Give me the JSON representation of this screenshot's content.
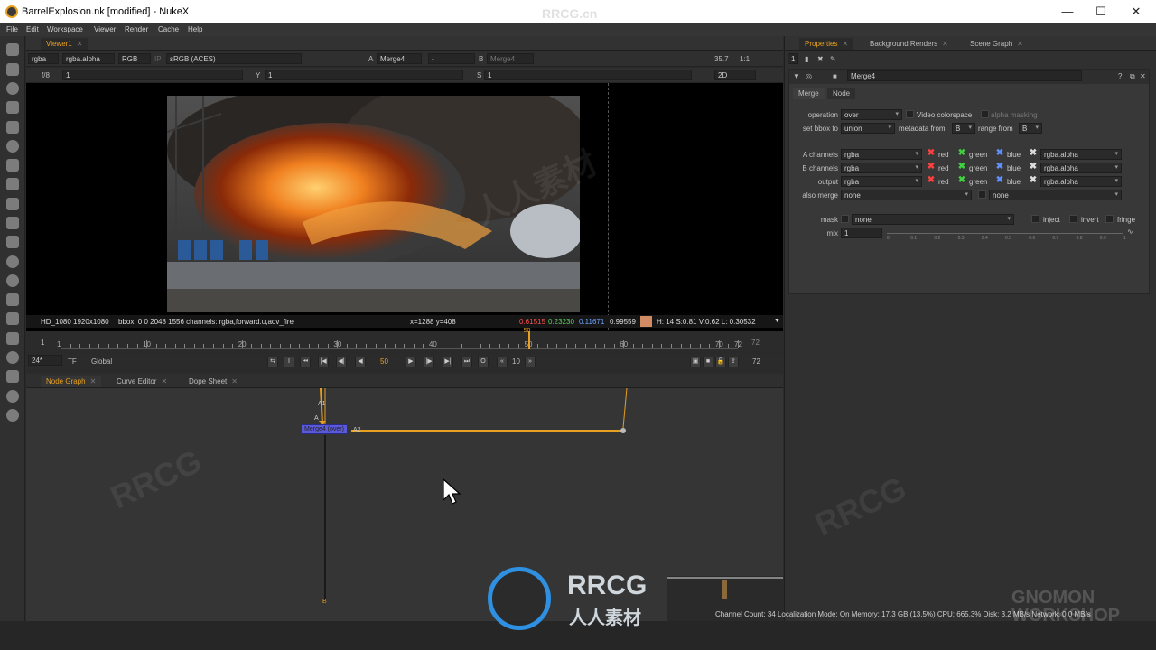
{
  "window": {
    "title": "BarrelExplosion.nk [modified] - NukeX",
    "minimize": "—",
    "maximize": "☐",
    "close": "✕"
  },
  "menu": [
    "File",
    "Edit",
    "Workspace",
    "Viewer",
    "Render",
    "Cache",
    "Help"
  ],
  "viewer": {
    "tab": "Viewer1",
    "channels": "rgba",
    "alpha": "rgba.alpha",
    "display": "RGB",
    "ip": "IP",
    "colorspace": "sRGB (ACES)",
    "input_a_label": "A",
    "input_a": "Merge4",
    "mode": "-",
    "input_b_label": "B",
    "input_b": "Merge4",
    "zoom": "35.7",
    "proxy": "1:1",
    "fstop": "f/8",
    "gain": "1",
    "gamma_label": "Y",
    "gamma": "1",
    "s_label": "S",
    "s_value": "1",
    "view_mode": "2D",
    "info": {
      "format": "HD_1080 1920x1080",
      "bbox": "bbox: 0 0 2048 1556 channels: rgba,forward.u,aov_fire",
      "coords": "x=1288 y=408",
      "r": "0.61515",
      "g": "0.23230",
      "b": "0.11671",
      "a": "0.99559",
      "swatch": "#d08a64",
      "hsvl": "H: 14 S:0.81 V:0.62  L: 0.30532"
    }
  },
  "timeline": {
    "start": "1",
    "end": "72",
    "current": "50",
    "ticks": [
      "1",
      "10",
      "20",
      "30",
      "40",
      "50",
      "60",
      "70",
      "72"
    ],
    "fps": "24*",
    "tf": "TF",
    "scope": "Global",
    "frame_field": "50",
    "step": "10",
    "end_field": "72"
  },
  "graph_tabs": [
    "Node Graph",
    "Curve Editor",
    "Dope Sheet"
  ],
  "node": {
    "label": "Merge4 (over)",
    "input_a1": "A1",
    "input_a2": "A2",
    "input_a": "A",
    "input_b": "B"
  },
  "props_tabs": [
    "Properties",
    "Background Renders",
    "Scene Graph"
  ],
  "props_count": "1",
  "props": {
    "node_name": "Merge4",
    "tabs": [
      "Merge",
      "Node"
    ],
    "operation_label": "operation",
    "operation": "over",
    "video_colorspace": "Video colorspace",
    "alpha_masking": "alpha masking",
    "set_bbox_label": "set bbox to",
    "set_bbox": "union",
    "metadata_label": "metadata from",
    "metadata": "B",
    "range_label": "range from",
    "range": "B",
    "a_channels_label": "A channels",
    "b_channels_label": "B channels",
    "output_label": "output",
    "channel_value": "rgba",
    "red": "red",
    "green": "green",
    "blue": "blue",
    "alpha_value": "rgba.alpha",
    "also_merge_label": "also merge",
    "also_merge": "none",
    "also_merge2": "none",
    "mask_label": "mask",
    "mask_value": "none",
    "inject": "inject",
    "invert": "invert",
    "fringe": "fringe",
    "mix_label": "mix",
    "mix_value": "1",
    "mix_ticks": [
      "0",
      "0.1",
      "0.2",
      "0.3",
      "0.4",
      "0.5",
      "0.6",
      "0.7",
      "0.8",
      "0.9",
      "1"
    ]
  },
  "status": "Channel Count: 34  Localization Mode: On  Memory: 17.3 GB (13.5%)  CPU: 665.3%  Disk: 3.2 MB/s  Network: 0.0 MB/s",
  "watermarks": {
    "top": "RRCG.cn",
    "logo_en": "RRCG",
    "logo_cn": "人人素材",
    "corner": "GNOMON WORKSHOP"
  },
  "colors": {
    "accent": "#e8a020",
    "node": "#5a5ad8",
    "bg": "#2b2b2b"
  }
}
